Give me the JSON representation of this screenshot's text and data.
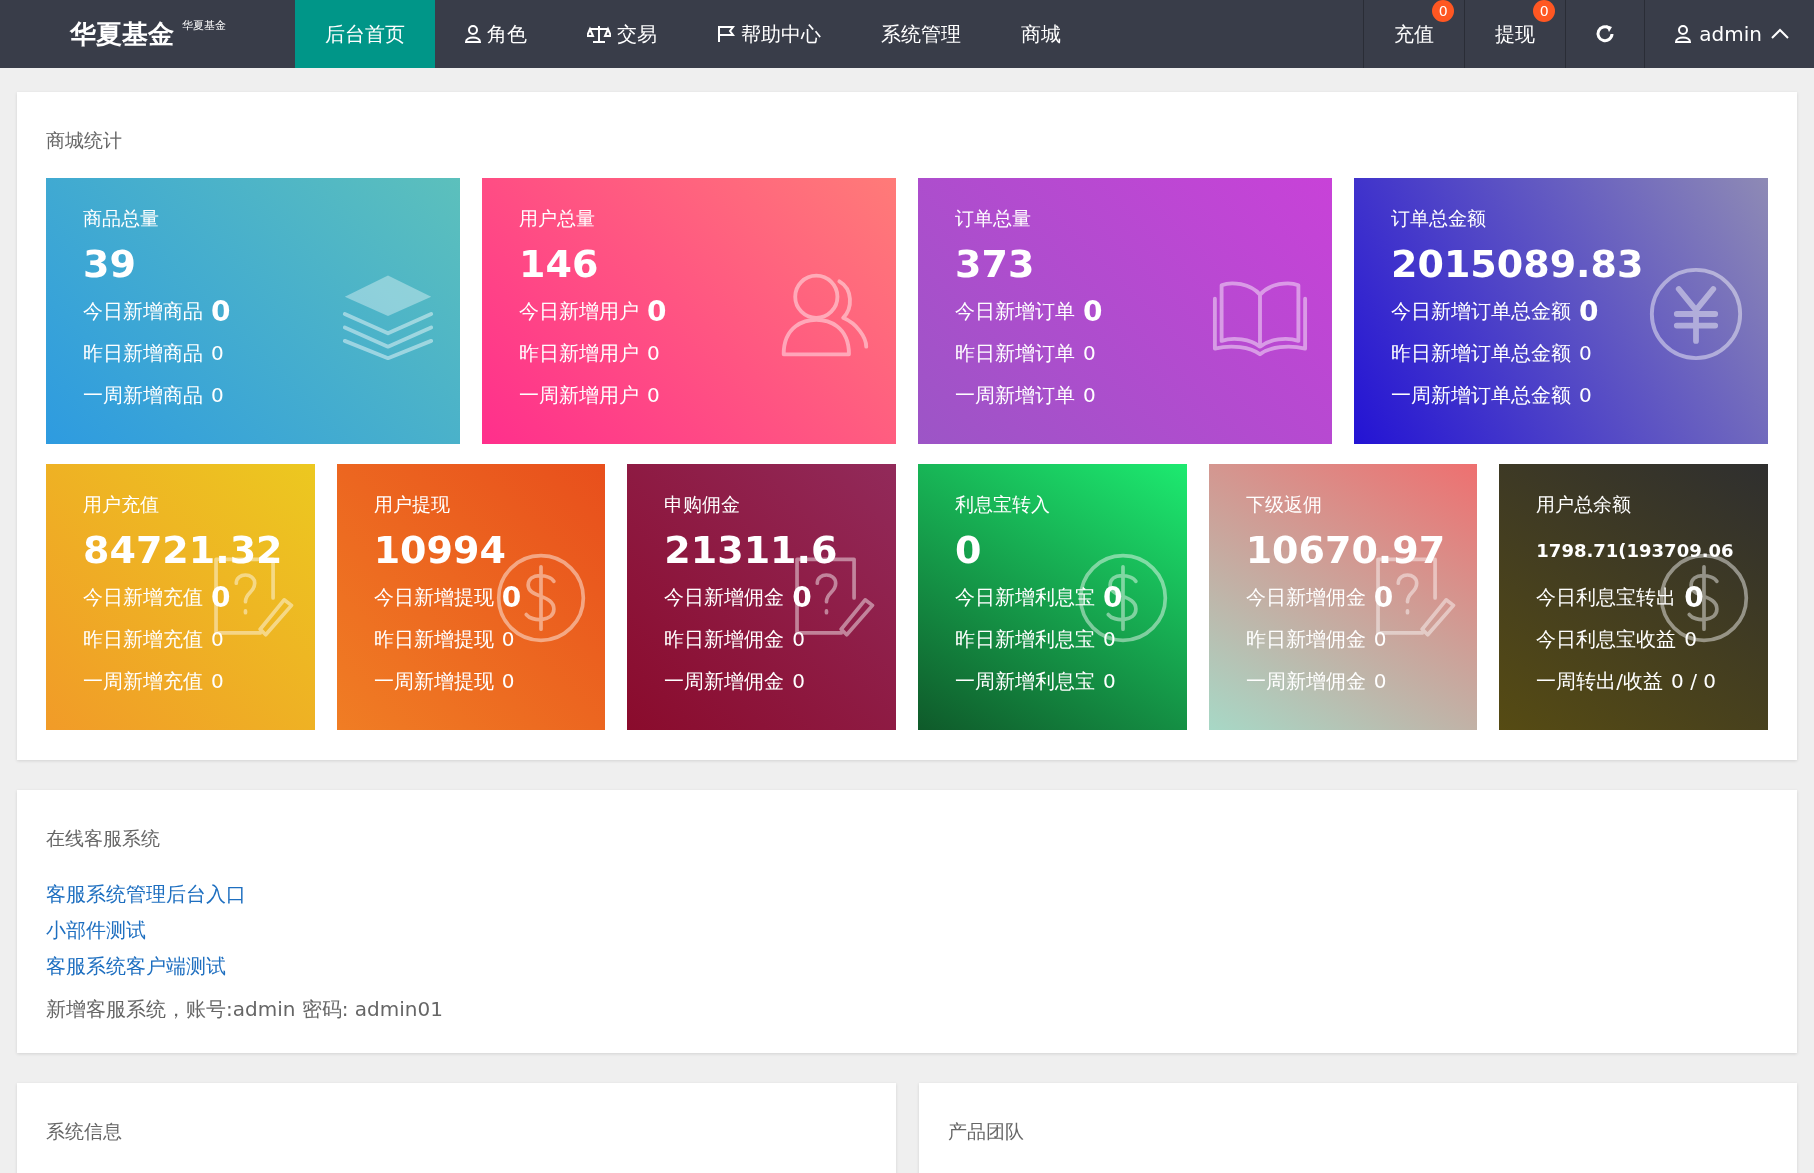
{
  "header": {
    "logo": "华夏基金",
    "logo_sub": "华夏基金",
    "nav": [
      {
        "label": "后台首页",
        "kind": "plain",
        "selected": true
      },
      {
        "label": "角色",
        "kind": "user",
        "selected": false
      },
      {
        "label": "交易",
        "kind": "scale",
        "selected": false
      },
      {
        "label": "帮助中心",
        "kind": "flag",
        "selected": false
      },
      {
        "label": "系统管理",
        "kind": "plain",
        "selected": false
      },
      {
        "label": "商城",
        "kind": "plain",
        "selected": false
      }
    ],
    "actions": [
      {
        "label": "充值",
        "badge": "0"
      },
      {
        "label": "提现",
        "badge": "0"
      }
    ],
    "user": "admin"
  },
  "mall_stats": {
    "title": "商城统计",
    "top_cards": [
      {
        "kind": "layers",
        "title": "商品总量",
        "value": "39",
        "rows": [
          {
            "label": "今日新增商品",
            "value": "0"
          },
          {
            "label": "昨日新增商品",
            "value": "0"
          },
          {
            "label": "一周新增商品",
            "value": "0"
          }
        ]
      },
      {
        "kind": "user",
        "title": "用户总量",
        "value": "146",
        "rows": [
          {
            "label": "今日新增用户",
            "value": "0"
          },
          {
            "label": "昨日新增用户",
            "value": "0"
          },
          {
            "label": "一周新增用户",
            "value": "0"
          }
        ]
      },
      {
        "kind": "book",
        "title": "订单总量",
        "value": "373",
        "rows": [
          {
            "label": "今日新增订单",
            "value": "0"
          },
          {
            "label": "昨日新增订单",
            "value": "0"
          },
          {
            "label": "一周新增订单",
            "value": "0"
          }
        ]
      },
      {
        "kind": "yen",
        "title": "订单总金额",
        "value": "2015089.83",
        "rows": [
          {
            "label": "今日新增订单总金额",
            "value": "0"
          },
          {
            "label": "昨日新增订单总金额",
            "value": "0"
          },
          {
            "label": "一周新增订单总金额",
            "value": "0"
          }
        ]
      }
    ],
    "bottom_cards": [
      {
        "kind": "note",
        "title": "用户充值",
        "value": "84721.32",
        "rows": [
          {
            "label": "今日新增充值",
            "value": "0"
          },
          {
            "label": "昨日新增充值",
            "value": "0"
          },
          {
            "label": "一周新增充值",
            "value": "0"
          }
        ]
      },
      {
        "kind": "dollar",
        "title": "用户提现",
        "value": "10994",
        "rows": [
          {
            "label": "今日新增提现",
            "value": "0"
          },
          {
            "label": "昨日新增提现",
            "value": "0"
          },
          {
            "label": "一周新增提现",
            "value": "0"
          }
        ]
      },
      {
        "kind": "note",
        "title": "申购佣金",
        "value": "21311.6",
        "rows": [
          {
            "label": "今日新增佣金",
            "value": "0"
          },
          {
            "label": "昨日新增佣金",
            "value": "0"
          },
          {
            "label": "一周新增佣金",
            "value": "0"
          }
        ]
      },
      {
        "kind": "dollar",
        "title": "利息宝转入",
        "value": "0",
        "rows": [
          {
            "label": "今日新增利息宝",
            "value": "0"
          },
          {
            "label": "昨日新增利息宝",
            "value": "0"
          },
          {
            "label": "一周新增利息宝",
            "value": "0"
          }
        ]
      },
      {
        "kind": "note",
        "title": "下级返佣",
        "value": "10670.97",
        "rows": [
          {
            "label": "今日新增佣金",
            "value": "0"
          },
          {
            "label": "昨日新增佣金",
            "value": "0"
          },
          {
            "label": "一周新增佣金",
            "value": "0"
          }
        ]
      },
      {
        "kind": "dollar",
        "title": "用户总余额",
        "value": "1798.71(193709.06",
        "small_value": true,
        "rows": [
          {
            "label": "今日利息宝转出",
            "value": "0"
          },
          {
            "label": "今日利息宝收益",
            "value": "0"
          },
          {
            "label": "一周转出/收益",
            "value": "0 / 0"
          }
        ]
      }
    ]
  },
  "support": {
    "title": "在线客服系统",
    "links": [
      "客服系统管理后台入口",
      "小部件测试",
      "客服系统客户端测试"
    ],
    "note": "新增客服系统，账号:admin 密码: admin01"
  },
  "bottom_panels": [
    {
      "title": "系统信息"
    },
    {
      "title": "产品团队"
    }
  ]
}
